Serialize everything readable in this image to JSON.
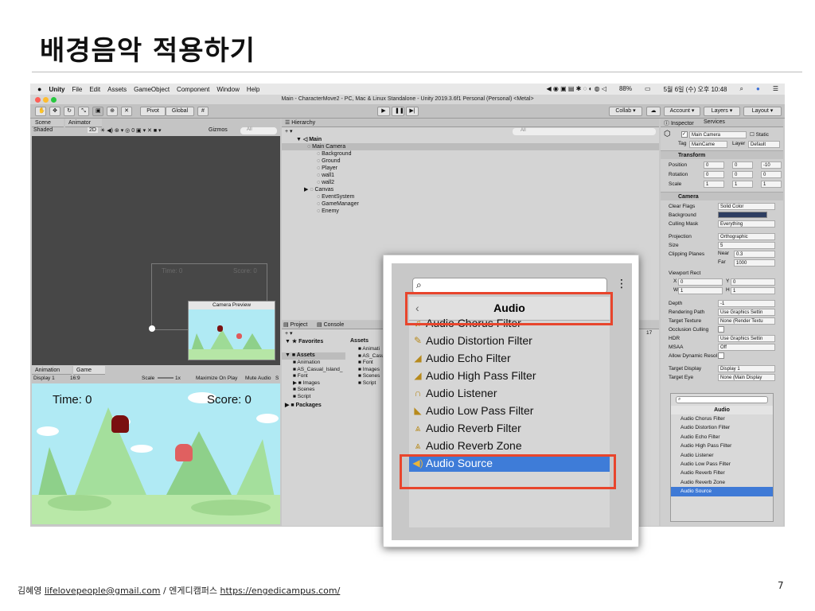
{
  "slide": {
    "title": "배경음악 적용하기",
    "page_number": "7",
    "footer_name": "김혜영",
    "footer_email": "lifelovepeople@gmail.com",
    "footer_sep": "/",
    "footer_org": "엔게디캠퍼스",
    "footer_url": "https://engedicampus.com/"
  },
  "macbar": {
    "apple": "",
    "app": "Unity",
    "menus": [
      "File",
      "Edit",
      "Assets",
      "GameObject",
      "Component",
      "Window",
      "Help"
    ],
    "battery": "88%",
    "datetime": "5월 6일 (수) 오후 10:48"
  },
  "window": {
    "title": "Main - CharacterMove2 - PC, Mac & Linux Standalone - Unity 2019.3.6f1 Personal (Personal) <Metal>"
  },
  "toolbar": {
    "pivot": "Pivot",
    "global": "Global",
    "collab": "Collab ▾",
    "account": "Account",
    "layers": "Layers",
    "layout": "Layout"
  },
  "scene": {
    "tab_scene": "Scene",
    "tab_animator": "Animator",
    "shading": "Shaded",
    "mode_2d": "2D",
    "gizmos": "Gizmos",
    "search": "All",
    "time_ghost": "Time: 0",
    "score_ghost": "Score: 0",
    "camera_preview": "Camera Preview"
  },
  "game": {
    "tab_animation": "Animation",
    "tab_game": "Game",
    "display": "Display 1",
    "aspect": "16:9",
    "scale_label": "Scale",
    "scale_value": "1x",
    "maximize": "Maximize On Play",
    "mute": "Mute Audio",
    "stats": "S",
    "time_text": "Time: 0",
    "score_text": "Score: 0"
  },
  "hierarchy": {
    "tab": "Hierarchy",
    "search": "All",
    "scene_name": "Main",
    "items": [
      "Main Camera",
      "Background",
      "Ground",
      "Player",
      "wall1",
      "wall2",
      "Canvas",
      "EventSystem",
      "GameManager",
      "Enemy"
    ]
  },
  "project": {
    "tab_project": "Project",
    "tab_console": "Console",
    "badge": "17",
    "favorites": "Favorites",
    "assets": "Assets",
    "tree": [
      "Animation",
      "AS_Casual_Island_",
      "Font",
      "Images",
      "Scenes",
      "Script"
    ],
    "packages": "Packages",
    "header": "Assets",
    "files": [
      "Animati",
      "AS_Casu",
      "Font",
      "Images",
      "Scenes",
      "Script"
    ]
  },
  "inspector": {
    "tab_inspector": "Inspector",
    "tab_services": "Services",
    "object_name": "Main Camera",
    "static": "Static",
    "tag_label": "Tag",
    "tag_value": "MainCame",
    "layer_label": "Layer",
    "layer_value": "Default",
    "transform": "Transform",
    "position": "Position",
    "rotation": "Rotation",
    "scale": "Scale",
    "pos": [
      "0",
      "0",
      "-10"
    ],
    "rot": [
      "0",
      "0",
      "0"
    ],
    "scl": [
      "1",
      "1",
      "1"
    ],
    "camera": "Camera",
    "fields": [
      {
        "label": "Clear Flags",
        "value": "Solid Color"
      },
      {
        "label": "Background",
        "value": ""
      },
      {
        "label": "Culling Mask",
        "value": "Everything"
      },
      {
        "label": "Projection",
        "value": "Orthographic"
      },
      {
        "label": "Size",
        "value": "5"
      },
      {
        "label": "Clipping Planes",
        "value": "0.3"
      },
      {
        "label": "",
        "value": "1000"
      },
      {
        "label": "Viewport Rect",
        "value": ""
      },
      {
        "label": "Depth",
        "value": "-1"
      },
      {
        "label": "Rendering Path",
        "value": "Use Graphics Settin"
      },
      {
        "label": "Target Texture",
        "value": "None (Render Textu"
      },
      {
        "label": "Occlusion Culling",
        "value": ""
      },
      {
        "label": "HDR",
        "value": "Use Graphics Settin"
      },
      {
        "label": "MSAA",
        "value": "Off"
      },
      {
        "label": "Allow Dynamic Resol",
        "value": ""
      },
      {
        "label": "Target Display",
        "value": "Display 1"
      },
      {
        "label": "Target Eye",
        "value": "None (Main Display"
      }
    ],
    "near": "Near",
    "far": "Far",
    "vx": "0",
    "vy": "0",
    "vw": "1",
    "vh": "1",
    "background_color": "#2d3d60"
  },
  "audio_menu": {
    "title": "Audio",
    "items": [
      "Audio Chorus Filter",
      "Audio Distortion Filter",
      "Audio Echo Filter",
      "Audio High Pass Filter",
      "Audio Listener",
      "Audio Low Pass Filter",
      "Audio Reverb Filter",
      "Audio Reverb Zone",
      "Audio Source"
    ],
    "selected": "Audio Source"
  },
  "colors": {
    "highlight": "#e8452c",
    "selection": "#3e7cd8",
    "sky": "#b0eaf4"
  }
}
